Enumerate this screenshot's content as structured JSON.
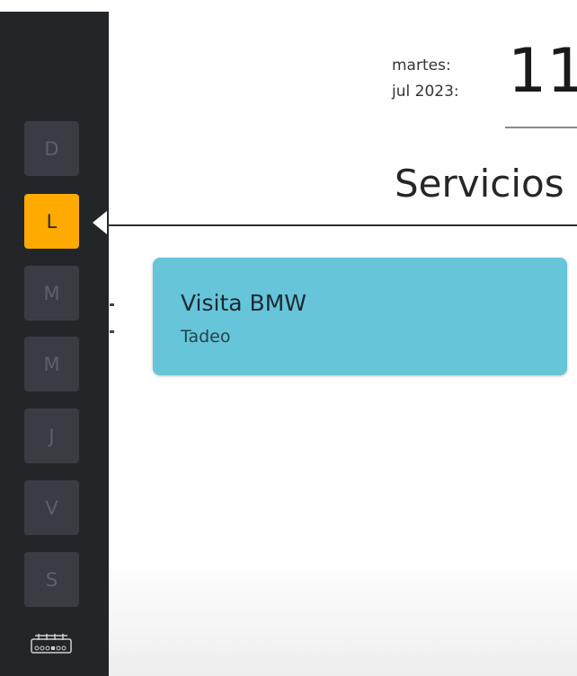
{
  "date": {
    "weekday": "martes:",
    "month_year": "jul 2023:",
    "day": "11"
  },
  "section": {
    "title": "Servicios"
  },
  "sidebar": {
    "days": [
      {
        "label": "D",
        "active": false
      },
      {
        "label": "L",
        "active": true
      },
      {
        "label": "M",
        "active": false
      },
      {
        "label": "M",
        "active": false
      },
      {
        "label": "J",
        "active": false
      },
      {
        "label": "V",
        "active": false
      },
      {
        "label": "S",
        "active": false
      }
    ],
    "bottom_icon": "calendar-grid-icon"
  },
  "services": [
    {
      "title": "Visita BMW",
      "subtitle": "Tadeo"
    }
  ],
  "colors": {
    "sidebar_bg": "#232629",
    "day_button_bg": "#393d43",
    "active_day": "#ffaa00",
    "card_bg": "#66c5d9"
  }
}
